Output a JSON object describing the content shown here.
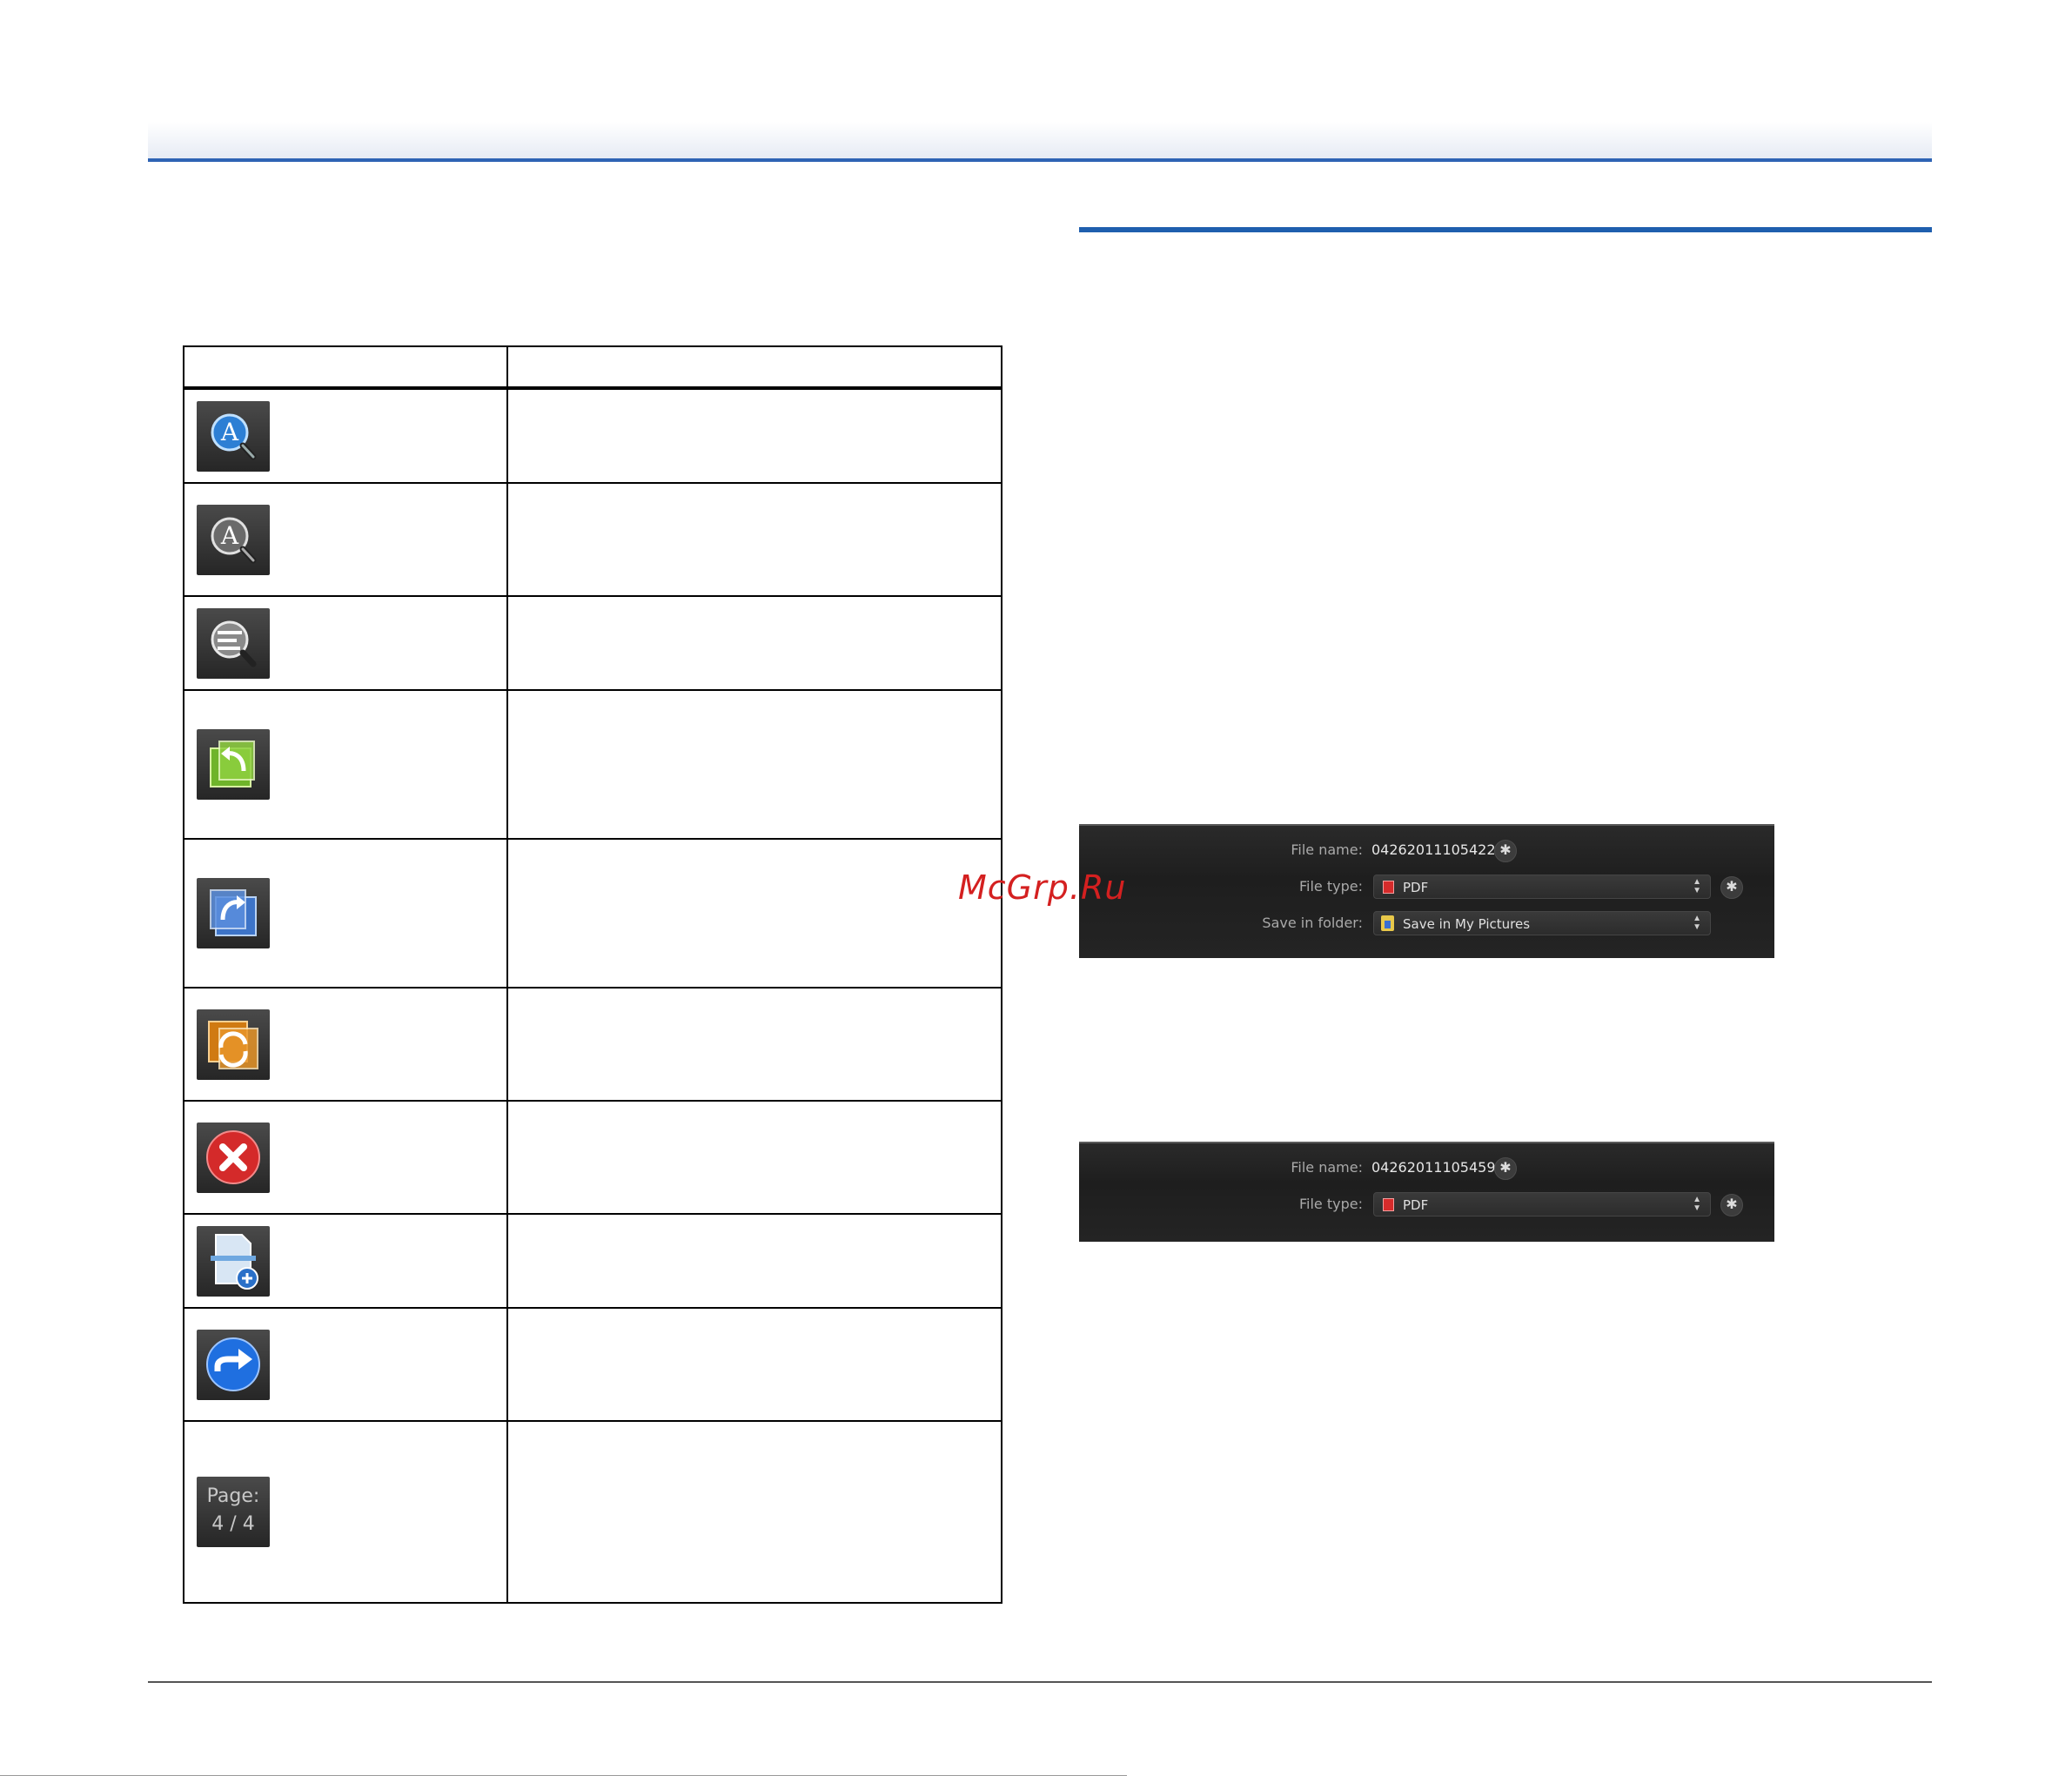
{
  "watermark": "McGrp.Ru",
  "icon_table": {
    "header": [
      "",
      ""
    ],
    "rows": [
      {
        "icon": "zoom-in-a-icon",
        "desc": ""
      },
      {
        "icon": "zoom-out-a-icon",
        "desc": ""
      },
      {
        "icon": "fit-text-magnifier-icon",
        "desc": ""
      },
      {
        "icon": "rotate-left-icon",
        "desc": ""
      },
      {
        "icon": "rotate-right-icon",
        "desc": ""
      },
      {
        "icon": "rotate-180-icon",
        "desc": ""
      },
      {
        "icon": "delete-icon",
        "desc": ""
      },
      {
        "icon": "add-page-scan-icon",
        "desc": ""
      },
      {
        "icon": "next-arrow-icon",
        "desc": ""
      },
      {
        "icon": "page-counter-icon",
        "desc": "",
        "page_label": "Page:",
        "page_value": "4 / 4"
      }
    ]
  },
  "screenshot1": {
    "file_name_label": "File name:",
    "file_name_value": "04262011105422",
    "file_type_label": "File type:",
    "file_type_value": "PDF",
    "save_folder_label": "Save in folder:",
    "save_folder_value": "Save in My Pictures"
  },
  "screenshot2": {
    "file_name_label": "File name:",
    "file_name_value": "04262011105459",
    "file_type_label": "File type:",
    "file_type_value": "PDF"
  },
  "colors": {
    "accent": "#1f5fae",
    "table_border": "#000000",
    "panel_bg": "#242424"
  }
}
